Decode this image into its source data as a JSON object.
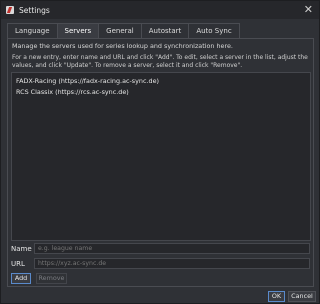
{
  "window": {
    "title": "Settings",
    "close_glyph": "✕"
  },
  "tabs": [
    {
      "label": "Language",
      "active": false
    },
    {
      "label": "Servers",
      "active": true
    },
    {
      "label": "General",
      "active": false
    },
    {
      "label": "Autostart",
      "active": false
    },
    {
      "label": "Auto Sync",
      "active": false
    }
  ],
  "servers_panel": {
    "description": "Manage the servers used for series lookup and synchronization here.",
    "instructions": "For a new entry, enter name and URL and click \"Add\". To edit, select a server in the list, adjust the values, and click \"Update\". To remove a server, select it and click \"Remove\".",
    "server_list": [
      {
        "text": "FADX-Racing  (https://fadx-racing.ac-sync.de)"
      },
      {
        "text": "RCS Classix  (https://rcs.ac-sync.de)"
      }
    ],
    "name_label": "Name",
    "name_value": "",
    "name_placeholder": "e.g. league name",
    "url_label": "URL",
    "url_value": "",
    "url_placeholder": "https://xyz.ac-sync.de",
    "add_label": "Add",
    "remove_label": "Remove"
  },
  "footer": {
    "ok_label": "OK",
    "cancel_label": "Cancel"
  },
  "colors": {
    "background": "#2f3136",
    "accent": "#5a8acb",
    "brand_red": "#c0322e"
  },
  "icons": {
    "app": "settings-app-icon",
    "close": "close-icon"
  }
}
